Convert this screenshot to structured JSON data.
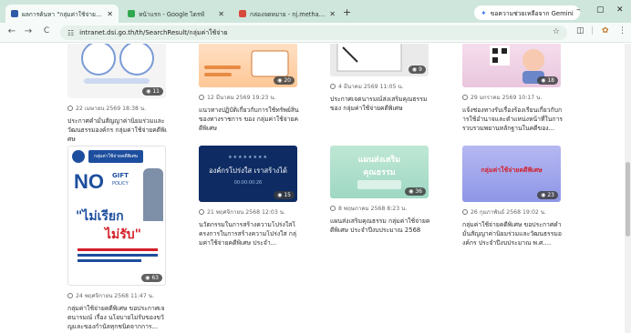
{
  "browser": {
    "tabs": [
      {
        "label": "ผลการค้นหา \"กลุ่มค่าใช้จ่าย\" คอ 1",
        "active": true,
        "favicon_color": "#2f5aa8"
      },
      {
        "label": "หน้าแรก - Google ไดรฟ์",
        "active": false,
        "favicon_color": "#2fa84f"
      },
      {
        "label": "กล่องจดหมาย - nj.methanol@gm",
        "active": false,
        "favicon_color": "#d84a3a"
      }
    ],
    "new_tab": "+",
    "gemini_label": "ขอความช่วยเหลือจาก Gemini",
    "url": "intranet.dsi.go.th/th/SearchResult/กลุ่มค่าใช้จ่าย",
    "win_min": "–",
    "win_max": "▢",
    "win_close": "✕",
    "nav_back": "←",
    "nav_forward": "→",
    "nav_reload": "C",
    "star_icon": "☆",
    "tb_icons": [
      "◫",
      "|",
      "✿",
      "⋮"
    ]
  },
  "cards": [
    {
      "date": "22 เมษายน 2569 18:38 น.",
      "views": "11",
      "title": "ประกาศคำมั่นสัญญาค่านิยมร่วมและวัฒนธรรมองค์กร กลุ่มค่าใช้จ่ายคดีพิเศษ"
    },
    {
      "date": "12 มีนาคม 2569 19:23 น.",
      "views": "20",
      "title": "แนวทางปฏิบัติเกี่ยวกับการใช้ทรัพย์สินของทางราชการ ของ กลุ่มค่าใช้จ่ายคดีพิเศษ"
    },
    {
      "date": "4 มีนาคม 2569 11:05 น.",
      "views": "9",
      "title": "ประกาศเจตนารมณ์ส่งเสริมคุณธรรม ของ กลุ่มค่าใช้จ่ายคดีพิเศษ"
    },
    {
      "date": "29 มกราคม 2569 10:17 น.",
      "views": "18",
      "title": "แจ้งช่องทางรับเรื่องร้องเรียนเกี่ยวกับการใช้อำนาจและตำแหน่งหน้าที่ในการรวบรวมพยานหลักฐานในคดีของ..."
    },
    {
      "date": "24 พฤศจิกายน 2568 11:47 น.",
      "views": "63",
      "title": "กลุ่มค่าใช้จ่ายคดีพิเศษ ขอประกาศเจตนารมณ์ เรื่อง นโยบายไม่รับของขวัญและของกำนัลทุกชนิดจากการ...",
      "poster": {
        "logo_text": "กลุ่มค่าใช้จ่ายคดีพิเศษ",
        "no_text": "NO",
        "gift_text": "GIFT",
        "policy_text": "POLICY",
        "slogan_1": "\"ไม่เรียก",
        "slogan_2": "ไม่รับ\""
      }
    },
    {
      "date": "21 พฤศจิกายน 2568 12:03 น.",
      "views": "15",
      "title": "นวัตกรรมในการสร้างความโปร่งใสโครงการในการสร้างความโปร่งใส กลุ่มค่าใช้จ่ายคดีพิเศษ ประจำ...",
      "banner": {
        "stars": "★★★★★★★★",
        "headline": "องค์กรโปร่งใส เราสร้างได้",
        "time": "00:00:00:26"
      }
    },
    {
      "date": "8 พฤษภาคม 2568 8:23 น.",
      "views": "36",
      "title": "แผนส่งเสริมคุณธรรม กลุ่มค่าใช้จ่ายคดีพิเศษ ประจำปีงบประมาณ 2568",
      "banner": {
        "line1": "แผนส่งเสริม",
        "line2": "คุณธรรม"
      }
    },
    {
      "date": "26 กุมภาพันธ์ 2568 19:02 น.",
      "views": "23",
      "title": "กลุ่มค่าใช้จ่ายคดีพิเศษ ขอประกาศคำมั่นสัญญาค่านิยมร่วมและวัฒนธรรมองค์กร ประจำปีงบประมาณ พ.ศ....",
      "banner": {
        "headline": "กลุ่มค่าใช้จ่ายคดีพิเศษ"
      }
    }
  ],
  "icons": {
    "eye": "◉"
  },
  "colors": {
    "tabbar": "#cfe6dd",
    "toolbar": "#f6fbf9",
    "badge": "#3c3c3c",
    "poster_blue": "#1d4e9e",
    "poster_red": "#d4202a"
  }
}
